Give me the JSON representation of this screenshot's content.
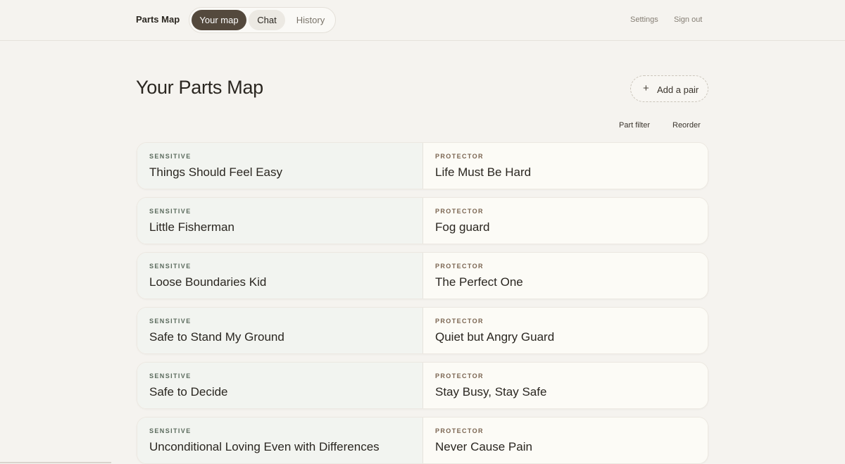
{
  "header": {
    "brand": "Parts Map",
    "tabs": [
      {
        "label": "Your map"
      },
      {
        "label": "Chat"
      },
      {
        "label": "History"
      }
    ],
    "settings": "Settings",
    "sign_out": "Sign out"
  },
  "main": {
    "title": "Your Parts Map",
    "add_pair": "Add a pair",
    "part_filter": "Part filter",
    "reorder": "Reorder",
    "pairs": [
      {
        "sensitive_tag": "SENSITIVE",
        "sensitive": "Things Should Feel Easy",
        "protector_tag": "PROTECTOR",
        "protector": "Life Must Be Hard"
      },
      {
        "sensitive_tag": "SENSITIVE",
        "sensitive": "Little Fisherman",
        "protector_tag": "PROTECTOR",
        "protector": "Fog guard"
      },
      {
        "sensitive_tag": "SENSITIVE",
        "sensitive": "Loose Boundaries Kid",
        "protector_tag": "PROTECTOR",
        "protector": "The Perfect One"
      },
      {
        "sensitive_tag": "SENSITIVE",
        "sensitive": "Safe to Stand My Ground",
        "protector_tag": "PROTECTOR",
        "protector": "Quiet but Angry Guard"
      },
      {
        "sensitive_tag": "SENSITIVE",
        "sensitive": "Safe to Decide",
        "protector_tag": "PROTECTOR",
        "protector": "Stay Busy, Stay Safe"
      },
      {
        "sensitive_tag": "SENSITIVE",
        "sensitive": "Unconditional Loving Even with Differences",
        "protector_tag": "PROTECTOR",
        "protector": "Never Cause Pain"
      }
    ]
  },
  "colors": {
    "background": "#f5f3ef",
    "active_tab": "#54493d",
    "sensitive_cell": "#f2f4f0",
    "protector_cell": "#fcfbf6"
  },
  "icons": {
    "add": "plus-icon"
  }
}
